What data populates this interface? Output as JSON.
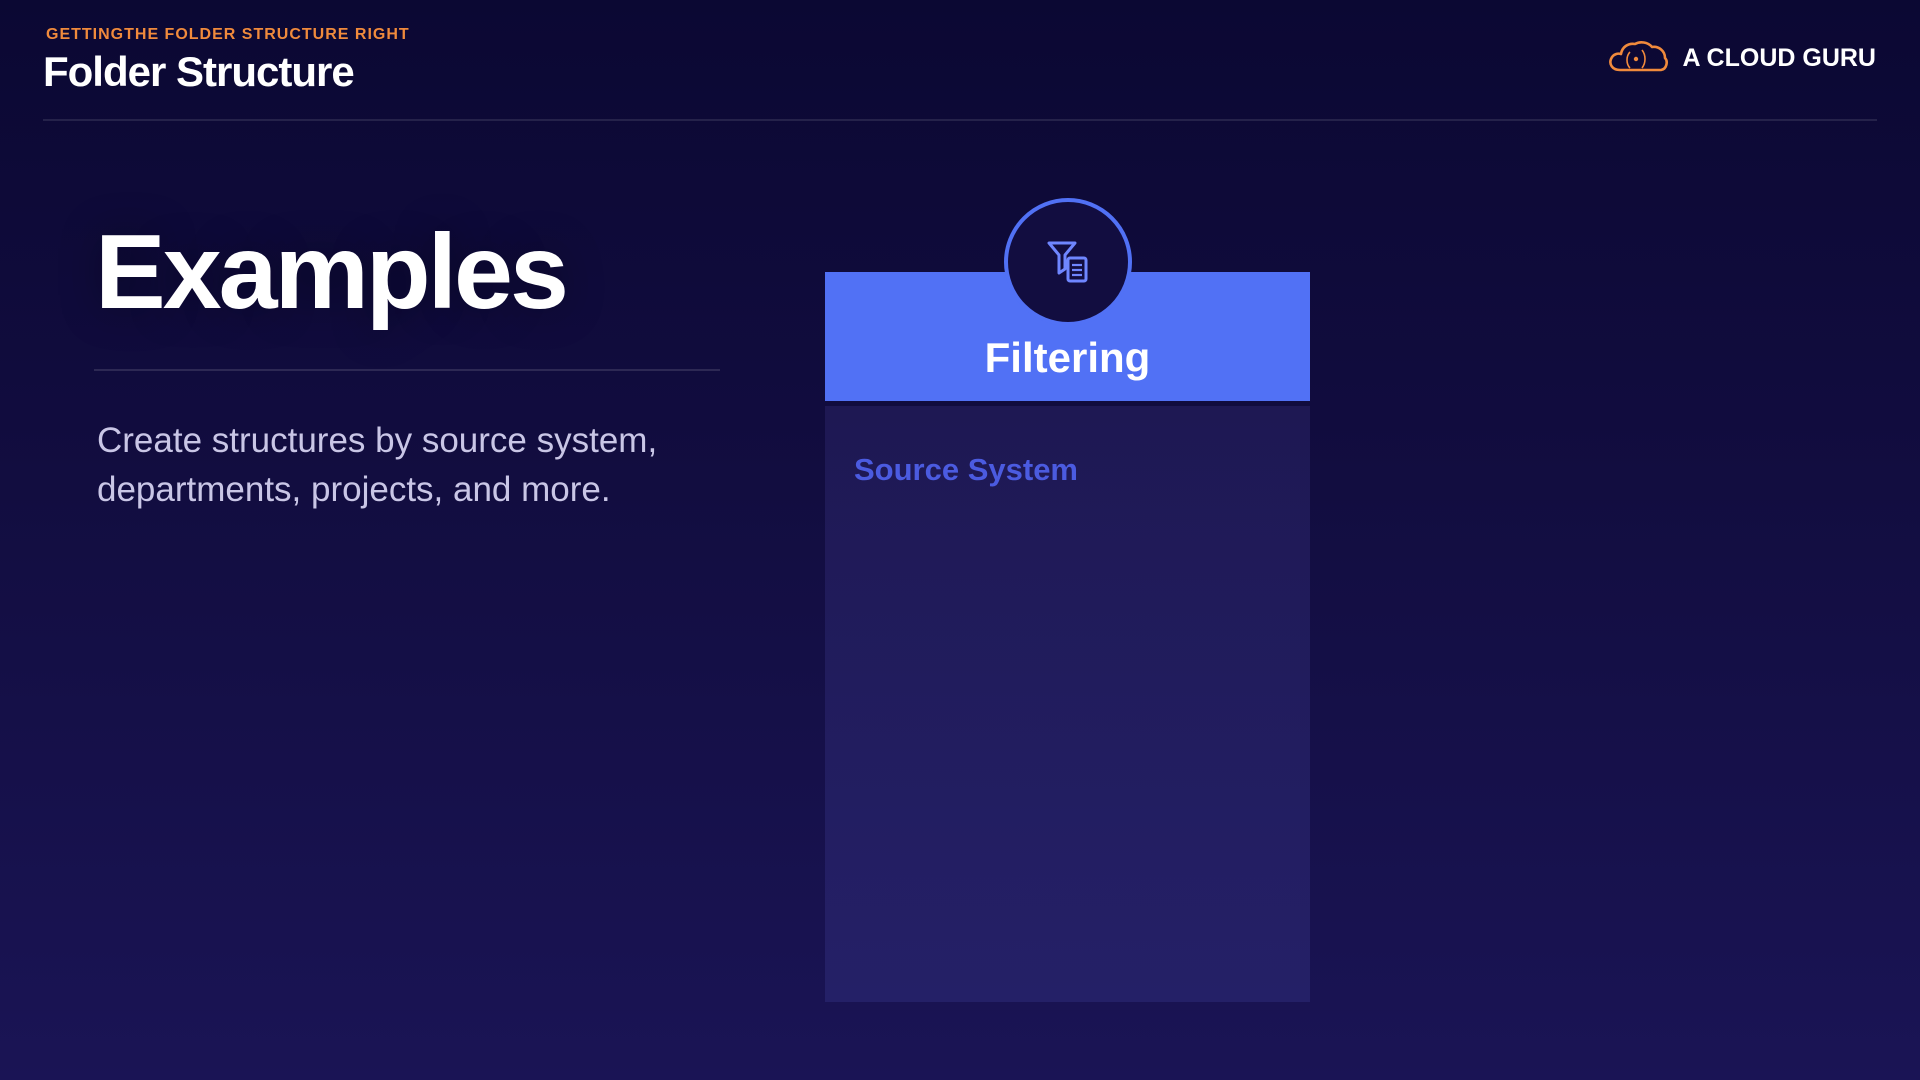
{
  "header": {
    "eyebrow": "GETTINGTHE FOLDER STRUCTURE RIGHT",
    "title": "Folder Structure"
  },
  "brand": {
    "name": "A CLOUD GURU",
    "logo_icon": "cloud-icon",
    "accent_color": "#f08a3c"
  },
  "section": {
    "heading": "Examples",
    "body": "Create structures by source system, departments, projects, and more."
  },
  "card": {
    "title": "Filtering",
    "icon": "filter-document-icon",
    "header_color": "#5171f5",
    "items": [
      "Source System"
    ]
  }
}
